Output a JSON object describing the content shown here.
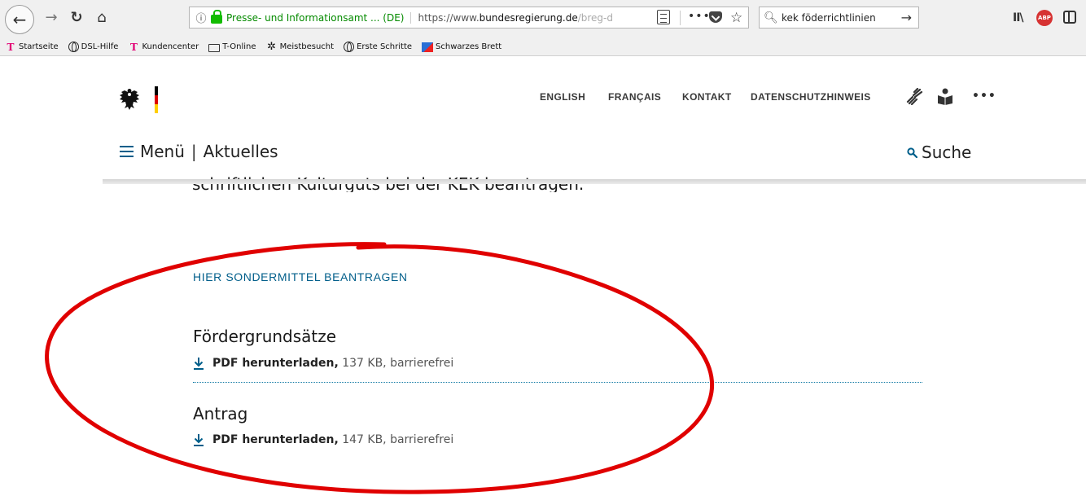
{
  "browser": {
    "url_identity": "Presse- und Informationsamt ... (DE)",
    "url_prefix": "https://www.",
    "url_domain": "bundesregierung.de",
    "url_path": "/breg-de",
    "search_value": "kek föderrichtlinien",
    "abp_label": "ABP"
  },
  "bookmarks": [
    {
      "label": "Startseite",
      "icon": "telekom-icon"
    },
    {
      "label": "DSL-Hilfe",
      "icon": "globe-icon"
    },
    {
      "label": "Kundencenter",
      "icon": "telekom-icon"
    },
    {
      "label": "T-Online",
      "icon": "folder-icon"
    },
    {
      "label": "Meistbesucht",
      "icon": "gear-icon"
    },
    {
      "label": "Erste Schritte",
      "icon": "globe-icon"
    },
    {
      "label": "Schwarzes Brett",
      "icon": "flag-icon"
    }
  ],
  "header": {
    "service_nav": [
      "ENGLISH",
      "FRANÇAIS",
      "KONTAKT",
      "DATENSCHUTZHINWEIS"
    ],
    "menu_label": "Menü",
    "menu_separator": "|",
    "section": "Aktuelles",
    "search_label": "Suche"
  },
  "content": {
    "partial_text": "schriftlichen Kulturguts bei der KEK beantragen.",
    "sondermittel_link": "HIER SONDERMITTEL BEANTRAGEN",
    "documents": [
      {
        "title": "Fördergrundsätze",
        "link": "PDF herunterladen,",
        "meta": " 137 KB, barrierefrei"
      },
      {
        "title": "Antrag",
        "link": "PDF herunterladen,",
        "meta": " 147 KB, barrierefrei"
      }
    ]
  },
  "colors": {
    "accent": "#005e8a",
    "annotation": "#e00000"
  }
}
